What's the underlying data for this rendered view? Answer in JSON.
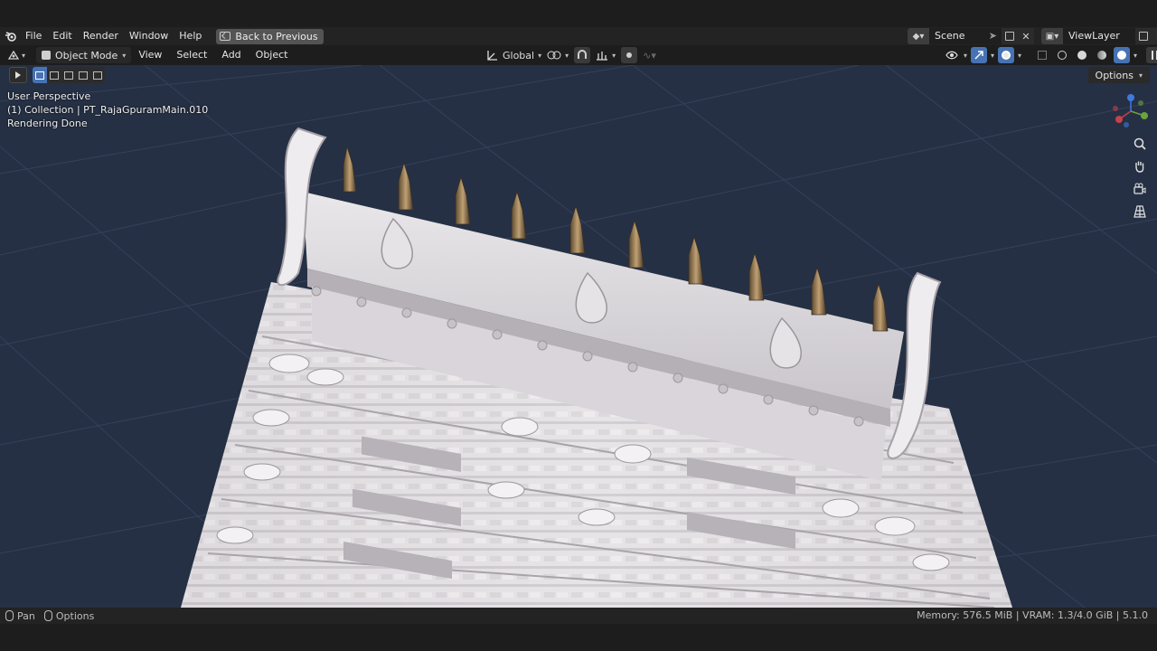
{
  "menubar": {
    "items": [
      "File",
      "Edit",
      "Render",
      "Window",
      "Help"
    ],
    "back_button": "Back to Previous",
    "scene": "Scene",
    "view_layer": "ViewLayer"
  },
  "viewport_header": {
    "mode": "Object Mode",
    "menus": [
      "View",
      "Select",
      "Add",
      "Object"
    ],
    "orientation": "Global"
  },
  "tool_header": {
    "options_label": "Options"
  },
  "viewport": {
    "perspective": "User Perspective",
    "collection": "(1) Collection | PT_RajaGpuramMain.010",
    "render_status": "Rendering Done"
  },
  "statusbar": {
    "pan_label": "Pan",
    "options_label": "Options",
    "stats": "Memory: 576.5 MiB | VRAM: 1.3/4.0 GiB | 5.1.0"
  },
  "colors": {
    "viewport_bg": "#253044",
    "accent": "#4772b3",
    "header_bg": "#232323"
  }
}
